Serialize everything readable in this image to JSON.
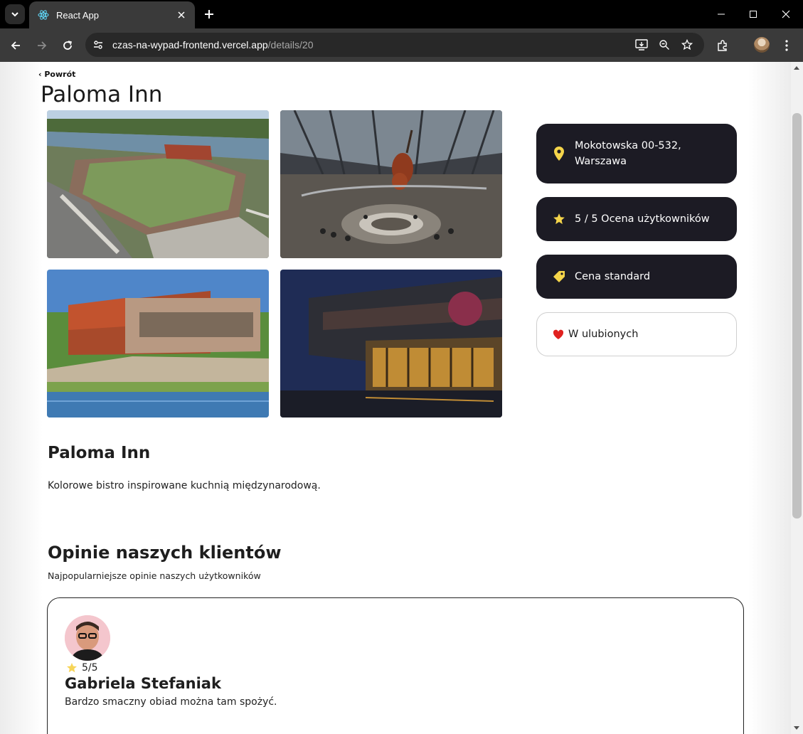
{
  "browser": {
    "tab_title": "React App",
    "url_host": "czas-na-wypad-frontend.vercel.app",
    "url_path": "/details/20"
  },
  "page": {
    "back_label": "‹ Powrót",
    "title": "Paloma Inn"
  },
  "info": {
    "address": "Mokotowska 00-532, Warszawa",
    "rating": "5 / 5 Ocena użytkowników",
    "price": "Cena standard",
    "favorite": "W ulubionych",
    "accent_color": "#f5d54a",
    "card_color": "#1c1b24",
    "heart_color": "#e0211f"
  },
  "about": {
    "title": "Paloma Inn",
    "description": "Kolorowe bistro inspirowane kuchnią międzynarodową."
  },
  "reviews": {
    "title": "Opinie naszych klientów",
    "subtitle": "Najpopularniejsze opinie naszych użytkowników",
    "items": [
      {
        "rating": "5/5",
        "name": "Gabriela Stefaniak",
        "text": "Bardzo smaczny obiad można tam spożyć."
      }
    ]
  }
}
